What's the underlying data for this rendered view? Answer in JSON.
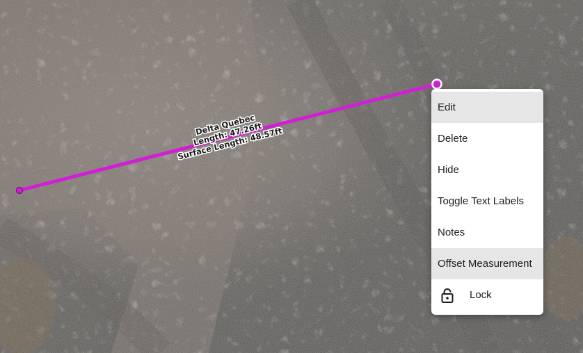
{
  "measurement": {
    "name": "Delta Quebec",
    "length": "Length: 47.26ft",
    "surface_length": "Surface Length: 48.57ft",
    "line_color": "#d11fd6"
  },
  "menu": {
    "items": [
      {
        "label": "Edit",
        "highlighted": true
      },
      {
        "label": "Delete",
        "highlighted": false
      },
      {
        "label": "Hide",
        "highlighted": false
      },
      {
        "label": "Toggle Text Labels",
        "highlighted": false
      },
      {
        "label": "Notes",
        "highlighted": false
      },
      {
        "label": "Offset Measurement",
        "highlighted": true
      },
      {
        "label": "Lock",
        "icon": "lock-icon",
        "highlighted": false
      }
    ]
  }
}
